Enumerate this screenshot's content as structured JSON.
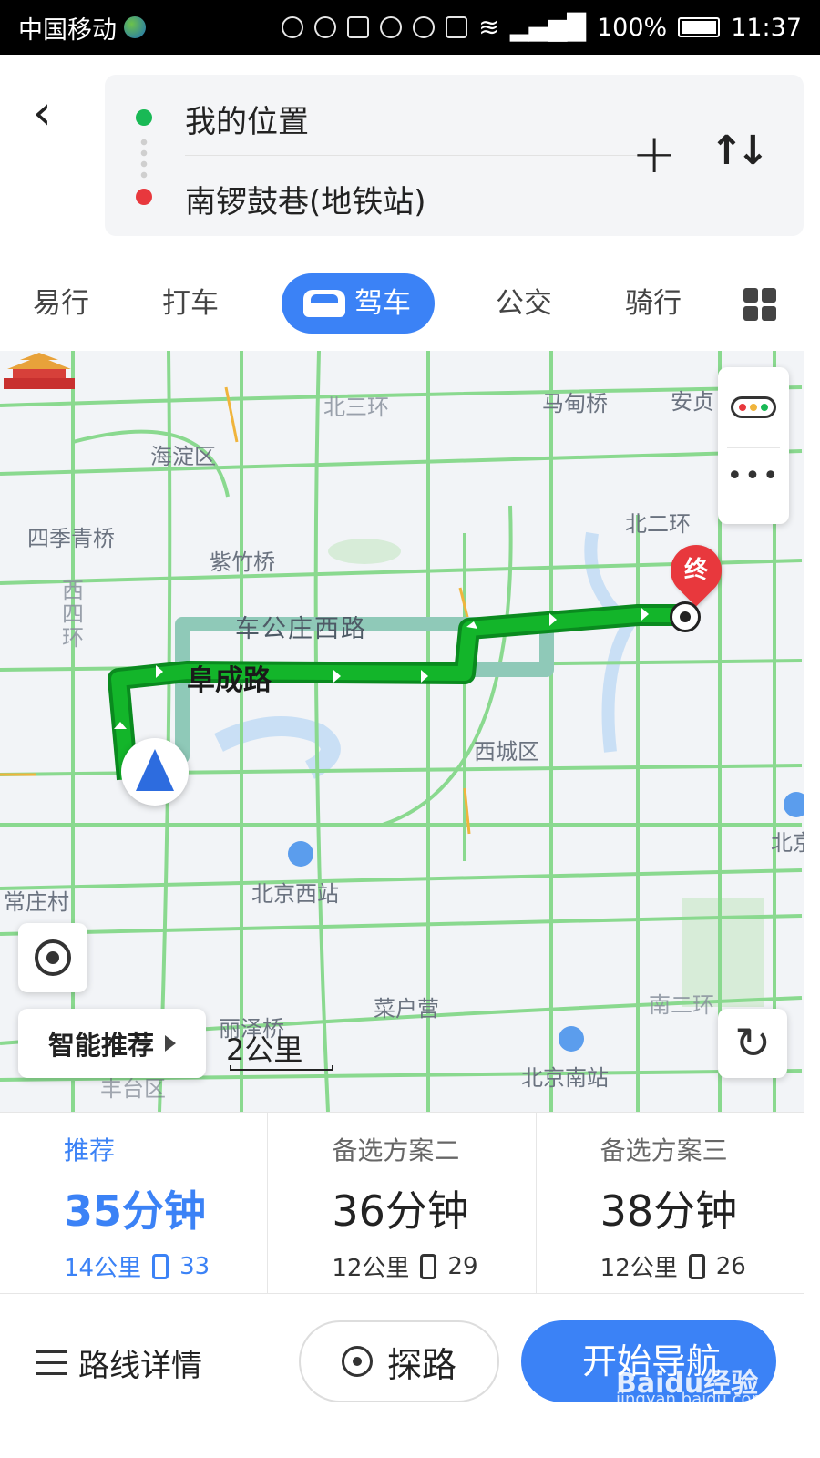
{
  "status_bar": {
    "carrier": "中国移动",
    "battery": "100%",
    "time": "11:37"
  },
  "route": {
    "from": "我的位置",
    "to": "南锣鼓巷(地铁站)"
  },
  "tabs": [
    {
      "label": "易行"
    },
    {
      "label": "打车"
    },
    {
      "label": "驾车",
      "active": true
    },
    {
      "label": "公交"
    },
    {
      "label": "骑行"
    }
  ],
  "map": {
    "labels": {
      "beisanhuan": "北三环",
      "madianqiao": "马甸桥",
      "anzhen": "安贞",
      "haidian": "海淀区",
      "siji": "四季青桥",
      "zizhu": "紫竹桥",
      "beierhuan": "北二环",
      "xisihuan": "西四环",
      "chegong": "车公庄西路",
      "fucheng": "阜成路",
      "xicheng": "西城区",
      "bj_west": "北京西站",
      "changzhuang": "常庄村",
      "caihu": "菜户营",
      "lize": "丽泽桥",
      "nanerhuan": "南二环",
      "fengtai": "丰台区",
      "bj_south": "北京南站",
      "bei": "北京"
    },
    "end_marker": "终",
    "smart_label": "智能推荐",
    "scale": "2公里"
  },
  "plans": [
    {
      "name": "推荐",
      "time": "35分钟",
      "distance": "14公里",
      "lights": "33"
    },
    {
      "name": "备选方案二",
      "time": "36分钟",
      "distance": "12公里",
      "lights": "29"
    },
    {
      "name": "备选方案三",
      "time": "38分钟",
      "distance": "12公里",
      "lights": "26"
    }
  ],
  "bottom": {
    "detail": "路线详情",
    "probe": "探路",
    "navigate": "开始导航"
  },
  "watermark": {
    "brand": "Baidu经验",
    "url": "jingyan.baidu.com"
  },
  "colors": {
    "accent": "#3b82f6",
    "route": "#13b52a",
    "start": "#19b955",
    "end": "#e8383d"
  }
}
